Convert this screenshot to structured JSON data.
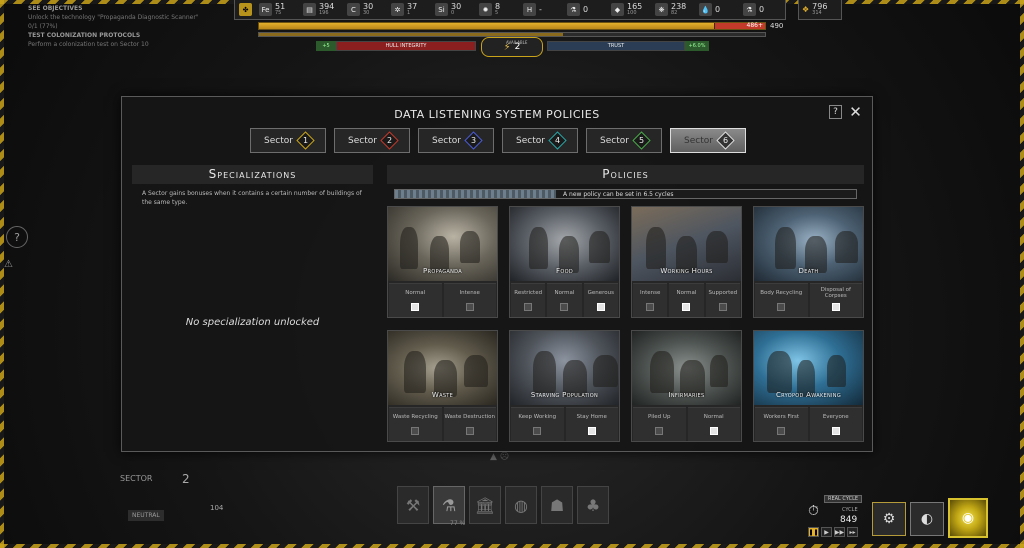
{
  "objectives": {
    "line1": "SEE OBJECTIVES",
    "line2": "Unlock the technology \"Propaganda Diagnostic Scanner\"",
    "line3": "0/1 (77%)",
    "line4": "TEST COLONIZATION PROTOCOLS",
    "line5": "Perform a colonization test on Sector 10"
  },
  "resources": [
    {
      "icon": "Fe",
      "name": "iron-icon",
      "value": "51",
      "sub": "75"
    },
    {
      "icon": "▤",
      "name": "materials-icon",
      "value": "394",
      "sub": "196"
    },
    {
      "icon": "C",
      "name": "carbon-icon",
      "value": "30",
      "sub": "30"
    },
    {
      "icon": "✲",
      "name": "component-icon",
      "value": "37",
      "sub": "1"
    },
    {
      "icon": "Si",
      "name": "silicon-icon",
      "value": "30",
      "sub": "0"
    },
    {
      "icon": "✹",
      "name": "energy-icon",
      "value": "8",
      "sub": "5"
    },
    {
      "icon": "H",
      "name": "hydrogen-icon",
      "value": "-",
      "sub": ""
    },
    {
      "icon": "⚗",
      "name": "chemicals-icon",
      "value": "0",
      "sub": ""
    },
    {
      "icon": "◆",
      "name": "crystal-icon",
      "value": "165",
      "sub": "100"
    },
    {
      "icon": "❋",
      "name": "plants-icon",
      "value": "238",
      "sub": "82"
    },
    {
      "icon": "💧",
      "name": "water-icon",
      "value": "0",
      "sub": ""
    },
    {
      "icon": "⚗",
      "name": "flask-icon",
      "value": "0",
      "sub": ""
    }
  ],
  "crew": {
    "value": "796",
    "sub": "314"
  },
  "mainbar": {
    "red_label": "486+",
    "value": "490"
  },
  "hull": {
    "delta": "+5",
    "label": "HULL INTEGRITY"
  },
  "trust": {
    "label": "TRUST",
    "delta": "+6.0%"
  },
  "available": {
    "label": "AVAILABLE",
    "value": "2"
  },
  "sector_bg": {
    "title": "SECTOR",
    "number": "2",
    "status": "NEUTRAL",
    "value": "104",
    "value2": "0.5"
  },
  "tools_pct": "77 %",
  "clock": {
    "real_label": "REAL CYCLE",
    "cycle_label": "CYCLE",
    "cycle": "849"
  },
  "dialog": {
    "title": "DATA LISTENING SYSTEM POLICIES",
    "help": "?",
    "close": "✕",
    "sectors": [
      {
        "label": "Sector",
        "num": "1",
        "color": "#c9a31a"
      },
      {
        "label": "Sector",
        "num": "2",
        "color": "#c0392b"
      },
      {
        "label": "Sector",
        "num": "3",
        "color": "#4a5bd4"
      },
      {
        "label": "Sector",
        "num": "4",
        "color": "#2aa3a3"
      },
      {
        "label": "Sector",
        "num": "5",
        "color": "#4aa84a"
      },
      {
        "label": "Sector",
        "num": "6",
        "color": "#e0e0e0"
      }
    ],
    "specializations": {
      "heading": "Specializations",
      "description": "A Sector gains bonuses when it contains a certain number of buildings of the same type.",
      "empty": "No specialization unlocked"
    },
    "policies": {
      "heading": "Policies",
      "cooldown": "A new policy can be set in 6.5 cycles",
      "cooldown_fraction": 0.35,
      "cards": [
        {
          "name": "Propaganda",
          "options": [
            {
              "label": "Normal",
              "on": true
            },
            {
              "label": "Intense",
              "on": false
            }
          ]
        },
        {
          "name": "Food",
          "options": [
            {
              "label": "Restricted",
              "on": false
            },
            {
              "label": "Normal",
              "on": false
            },
            {
              "label": "Generous",
              "on": true
            }
          ]
        },
        {
          "name": "Working Hours",
          "options": [
            {
              "label": "Intense",
              "on": false
            },
            {
              "label": "Normal",
              "on": true
            },
            {
              "label": "Supported",
              "on": false
            }
          ]
        },
        {
          "name": "Death",
          "options": [
            {
              "label": "Body Recycling",
              "on": false
            },
            {
              "label": "Disposal of Corpses",
              "on": true
            }
          ]
        },
        {
          "name": "Waste",
          "options": [
            {
              "label": "Waste Recycling",
              "on": false
            },
            {
              "label": "Waste Destruction",
              "on": false
            }
          ]
        },
        {
          "name": "Starving Population",
          "options": [
            {
              "label": "Keep Working",
              "on": false
            },
            {
              "label": "Stay Home",
              "on": true
            }
          ]
        },
        {
          "name": "Infirmaries",
          "options": [
            {
              "label": "Piled Up",
              "on": false
            },
            {
              "label": "Normal",
              "on": true
            }
          ]
        },
        {
          "name": "Cryopod Awakening",
          "options": [
            {
              "label": "Workers First",
              "on": false
            },
            {
              "label": "Everyone",
              "on": true
            }
          ]
        }
      ]
    }
  }
}
